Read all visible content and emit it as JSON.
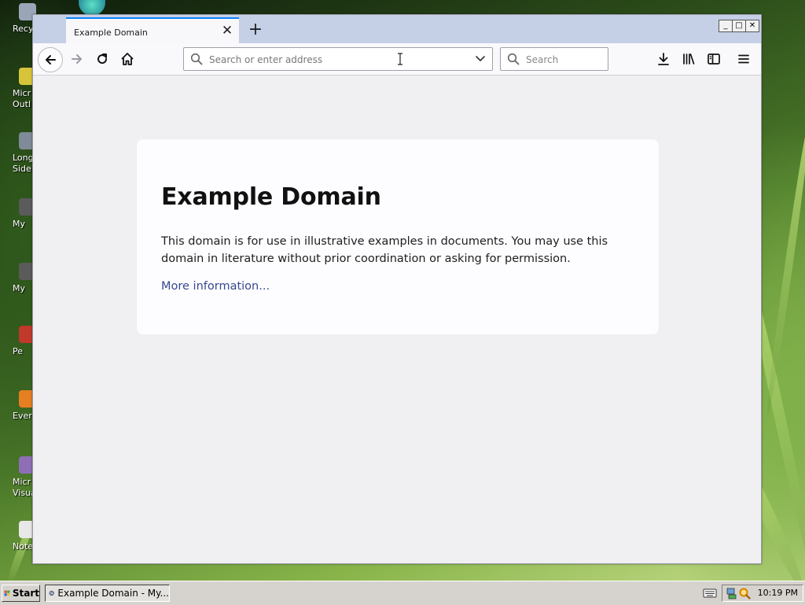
{
  "desktop": {
    "icons": [
      {
        "label": "Recyc",
        "icon": "recycle-bin-icon",
        "color": "#9aa6b8"
      },
      {
        "label": "Micr\nOutl",
        "icon": "outlook-icon",
        "color": "#d7c43a"
      },
      {
        "label": "Long\nSide",
        "icon": "shortcut-icon",
        "color": "#7f8b98"
      },
      {
        "label": "My",
        "icon": "shortcut-icon",
        "color": "#5b5b5b"
      },
      {
        "label": "My",
        "icon": "shortcut-icon",
        "color": "#5b5b5b"
      },
      {
        "label": "Pe",
        "icon": "app-icon",
        "color": "#c0392b"
      },
      {
        "label": "Every",
        "icon": "search-app-icon",
        "color": "#e67e22"
      },
      {
        "label": "Micr\nVisual",
        "icon": "visual-studio-icon",
        "color": "#8e6fb5"
      },
      {
        "label": "Notep",
        "icon": "notepad-icon",
        "color": "#e8e8e8"
      }
    ]
  },
  "browser": {
    "tab": {
      "title": "Example Domain",
      "close_glyph": "✕"
    },
    "new_tab_glyph": "+",
    "window_controls": {
      "minimize": "_",
      "maximize": "□",
      "close": "✕"
    },
    "nav": {
      "back_icon": "back-arrow-icon",
      "forward_icon": "forward-arrow-icon",
      "reload_icon": "reload-icon",
      "home_icon": "home-icon"
    },
    "urlbar": {
      "placeholder": "Search or enter address",
      "value": ""
    },
    "searchbar": {
      "placeholder": "Search",
      "value": ""
    },
    "toolbar_right": [
      "downloads-icon",
      "library-icon",
      "sidebar-icon",
      "menu-icon"
    ]
  },
  "page": {
    "title": "Example Domain",
    "body": "This domain is for use in illustrative examples in documents. You may use this domain in literature without prior coordination or asking for permission.",
    "link": "More information..."
  },
  "taskbar": {
    "start_label": "Start",
    "task_label": "Example Domain - My...",
    "clock": "10:19 PM"
  },
  "colors": {
    "tab_accent": "#0a84ff",
    "link": "#38488f",
    "tabstrip": "#c5d0e6"
  }
}
